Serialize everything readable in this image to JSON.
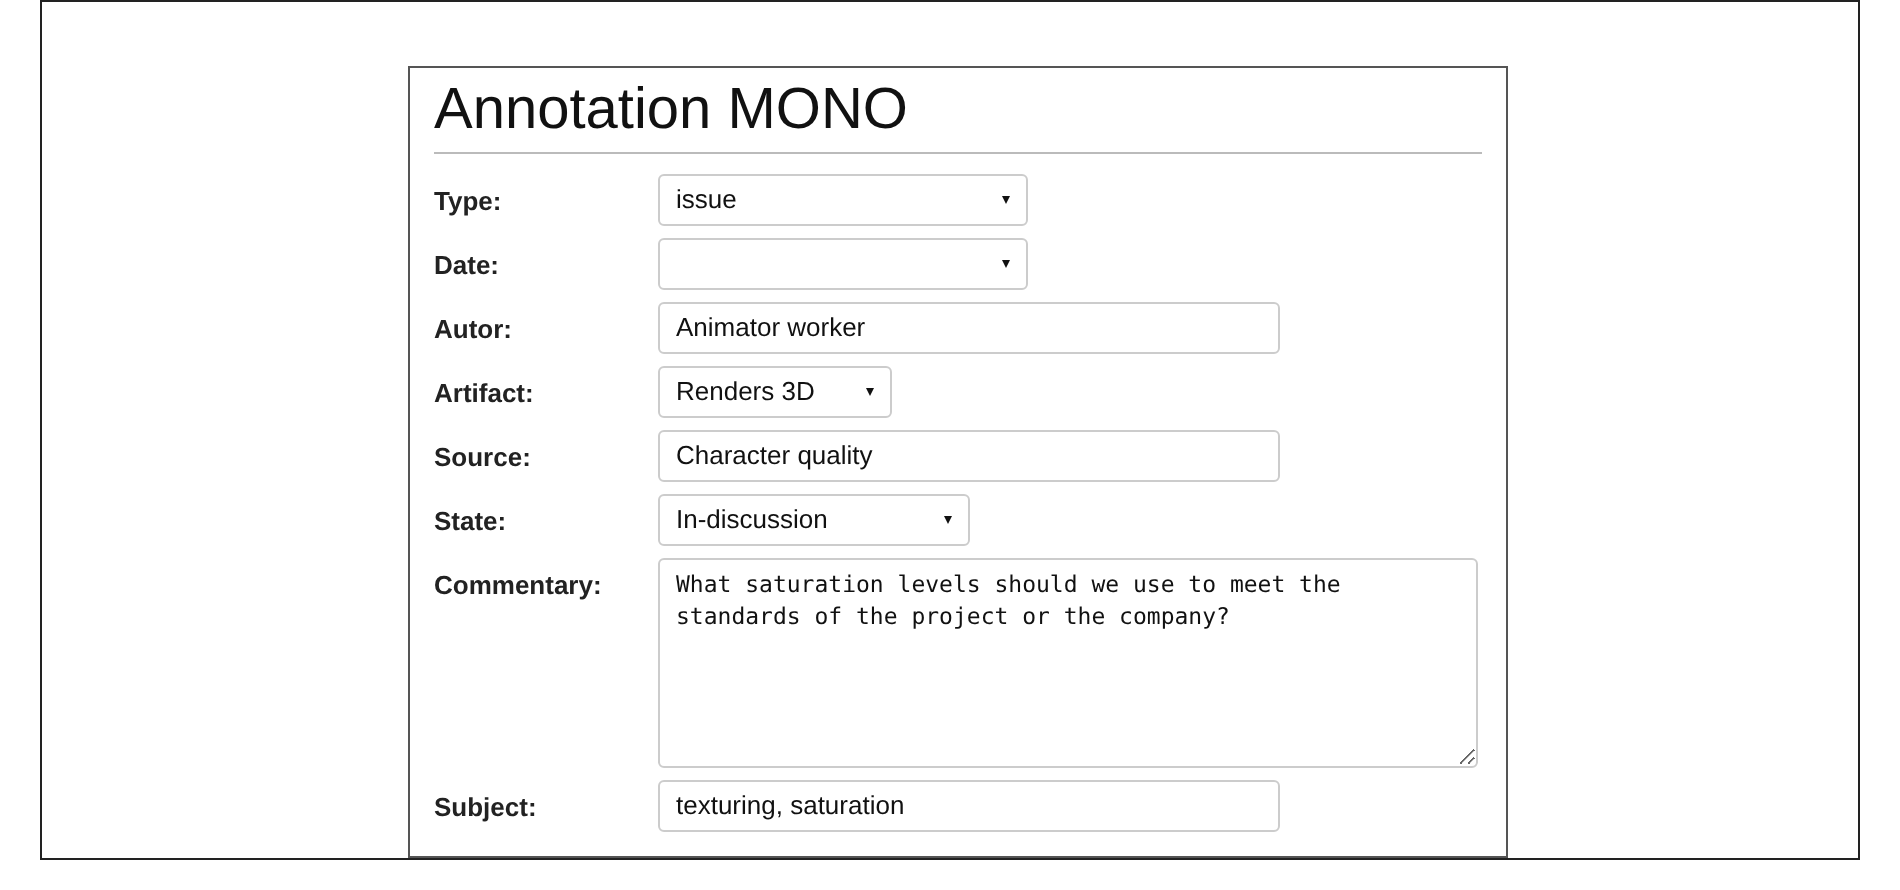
{
  "form": {
    "title": "Annotation MONO",
    "fields": [
      {
        "label": "Type:",
        "kind": "select",
        "value": "issue"
      },
      {
        "label": "Date:",
        "kind": "select"
      },
      {
        "label": "Autor:",
        "kind": "input",
        "value": "Animator worker"
      },
      {
        "label": "Artifact:",
        "kind": "select",
        "value": "Renders 3D"
      },
      {
        "label": "Source:",
        "kind": "input",
        "value": "Character quality"
      },
      {
        "label": "State:",
        "kind": "select",
        "value": "In-discussion"
      },
      {
        "label": "Commentary:",
        "kind": "textarea",
        "value": "What saturation levels should we use to meet the standards of the project or the company?"
      },
      {
        "label": "Subject:",
        "kind": "input",
        "value": "texturing, saturation"
      }
    ]
  }
}
